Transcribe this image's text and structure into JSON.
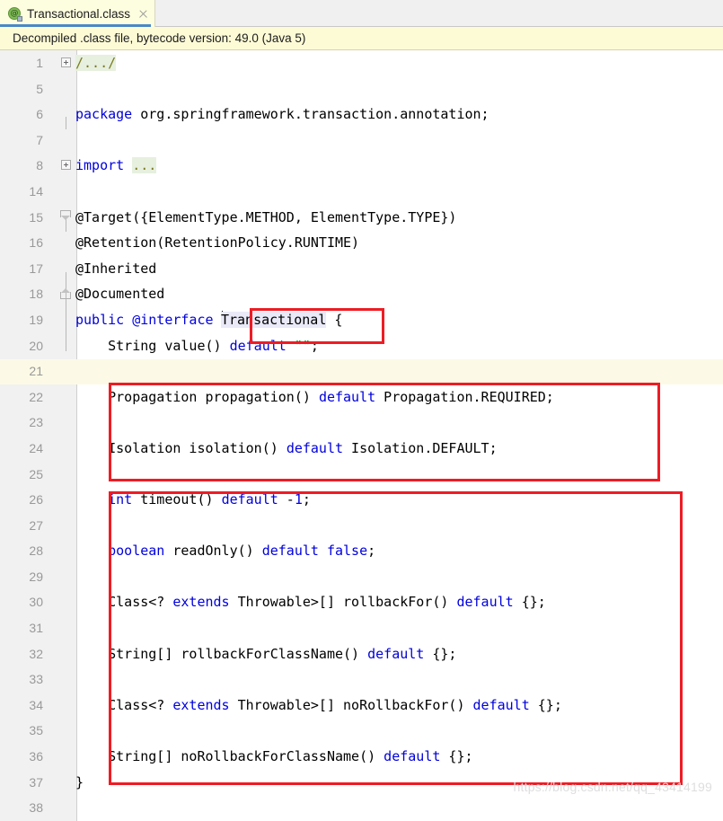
{
  "tab": {
    "title": "Transactional.class",
    "icon": "annotation-class-icon",
    "icon_glyph": "@",
    "close_label": "×"
  },
  "notification": {
    "message": "Decompiled .class file, bytecode version: 49.0 (Java 5)"
  },
  "watermark": {
    "text": "https://blog.csdn.net/qq_43414199"
  },
  "colors": {
    "keyword": "#0000dd",
    "string": "#008000",
    "number": "#0000dd",
    "plain": "#000000",
    "fold_bg": "#e7f0df",
    "caret_line": "#fcfae6",
    "identifier_highlight": "#e9e9f7",
    "annotation_box": "#ee1c24",
    "tab_bg": "#fdfddf",
    "tab_underline": "#4a88c7",
    "notification_bg": "#fdfbd6",
    "gutter_bg": "#f1f1f1"
  },
  "lines": [
    {
      "no": "1",
      "fold": "plus",
      "text": "/.../",
      "kind": "folded-comment"
    },
    {
      "no": "5",
      "fold": "",
      "text": "",
      "kind": "blank"
    },
    {
      "no": "6",
      "fold": "",
      "text": "package org.springframework.transaction.annotation;",
      "kind": "package"
    },
    {
      "no": "7",
      "fold": "",
      "text": "",
      "kind": "blank"
    },
    {
      "no": "8",
      "fold": "plus",
      "text": "import ...",
      "kind": "folded-import"
    },
    {
      "no": "14",
      "fold": "",
      "text": "",
      "kind": "blank"
    },
    {
      "no": "15",
      "fold": "arrow",
      "text": "@Target({ElementType.METHOD, ElementType.TYPE})",
      "kind": "annotation"
    },
    {
      "no": "16",
      "fold": "",
      "text": "@Retention(RetentionPolicy.RUNTIME)",
      "kind": "annotation"
    },
    {
      "no": "17",
      "fold": "",
      "text": "@Inherited",
      "kind": "annotation"
    },
    {
      "no": "18",
      "fold": "end",
      "text": "@Documented",
      "kind": "annotation"
    },
    {
      "no": "19",
      "fold": "",
      "text": "public @interface Transactional {",
      "kind": "declaration"
    },
    {
      "no": "20",
      "fold": "",
      "text": "    String value() default \"\";",
      "kind": "member"
    },
    {
      "no": "21",
      "fold": "",
      "text": "",
      "kind": "blank"
    },
    {
      "no": "22",
      "fold": "",
      "text": "    Propagation propagation() default Propagation.REQUIRED;",
      "kind": "member"
    },
    {
      "no": "23",
      "fold": "",
      "text": "",
      "kind": "blank"
    },
    {
      "no": "24",
      "fold": "",
      "text": "    Isolation isolation() default Isolation.DEFAULT;",
      "kind": "member"
    },
    {
      "no": "25",
      "fold": "",
      "text": "",
      "kind": "blank"
    },
    {
      "no": "26",
      "fold": "",
      "text": "    int timeout() default -1;",
      "kind": "member"
    },
    {
      "no": "27",
      "fold": "",
      "text": "",
      "kind": "blank"
    },
    {
      "no": "28",
      "fold": "",
      "text": "    boolean readOnly() default false;",
      "kind": "member"
    },
    {
      "no": "29",
      "fold": "",
      "text": "",
      "kind": "blank"
    },
    {
      "no": "30",
      "fold": "",
      "text": "    Class<? extends Throwable>[] rollbackFor() default {};",
      "kind": "member"
    },
    {
      "no": "31",
      "fold": "",
      "text": "",
      "kind": "blank"
    },
    {
      "no": "32",
      "fold": "",
      "text": "    String[] rollbackForClassName() default {};",
      "kind": "member"
    },
    {
      "no": "33",
      "fold": "",
      "text": "",
      "kind": "blank"
    },
    {
      "no": "34",
      "fold": "",
      "text": "    Class<? extends Throwable>[] noRollbackFor() default {};",
      "kind": "member"
    },
    {
      "no": "35",
      "fold": "",
      "text": "",
      "kind": "blank"
    },
    {
      "no": "36",
      "fold": "",
      "text": "    String[] noRollbackForClassName() default {};",
      "kind": "member"
    },
    {
      "no": "37",
      "fold": "",
      "text": "}",
      "kind": "close-brace"
    },
    {
      "no": "38",
      "fold": "",
      "text": "",
      "kind": "blank"
    }
  ],
  "tokens": {
    "kw_package": "package",
    "pkg_name": "org.springframework.transaction.annotation;",
    "kw_import": "import",
    "fold_dots": "...",
    "fold_comment": "/.../",
    "l15": "@Target({ElementType.METHOD, ElementType.TYPE})",
    "l16": "@Retention(RetentionPolicy.RUNTIME)",
    "l17": "@Inherited",
    "l18": "@Documented",
    "kw_public": "public",
    "at_interface": "@interface",
    "type_name": "Transactional",
    "open_brace": "{",
    "l20_a": "    String value() ",
    "kw_default": "default",
    "l20_str": "\"\"",
    "semi": ";",
    "l22_a": "    Propagation propagation() ",
    "l22_b": " Propagation.REQUIRED;",
    "l24_a": "    Isolation isolation() ",
    "l24_b": " Isolation.DEFAULT;",
    "l26_pre": "    ",
    "kw_int": "int",
    "l26_a": " timeout() ",
    "l26_minus": " -",
    "l26_num": "1",
    "kw_boolean": "boolean",
    "l28_a": " readOnly() ",
    "kw_false": "false",
    "l30_a": "    Class<? ",
    "kw_extends": "extends",
    "l30_b": " Throwable>[] rollbackFor() ",
    "empty_braces": " {};",
    "l32_a": "    String[] rollbackForClassName() ",
    "l34_b": " Throwable>[] noRollbackFor() ",
    "l36_a": "    String[] noRollbackForClassName() ",
    "close_brace": "}"
  },
  "annotations": {
    "box_type_name": "red-rectangle-around-transactional",
    "box_group_1": "red-rectangle-propagation-isolation",
    "box_group_2": "red-rectangle-remaining-attributes"
  }
}
